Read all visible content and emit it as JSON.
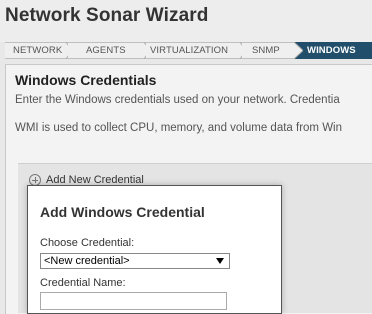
{
  "window": {
    "title": "Network Sonar Wizard"
  },
  "wizard": {
    "steps": [
      {
        "label": "NETWORK",
        "active": false
      },
      {
        "label": "AGENTS",
        "active": false
      },
      {
        "label": "VIRTUALIZATION",
        "active": false
      },
      {
        "label": "SNMP",
        "active": false
      },
      {
        "label": "WINDOWS",
        "active": true
      }
    ]
  },
  "main": {
    "heading": "Windows Credentials",
    "description": "Enter the Windows credentials used on your network. Credentia",
    "wmi_note": "WMI is used to collect CPU, memory, and volume data from Win",
    "add_credential_label": "Add New Credential"
  },
  "dialog": {
    "title": "Add Windows Credential",
    "choose_label": "Choose Credential:",
    "choose_value": "<New credential>",
    "name_label": "Credential Name:",
    "name_value": "",
    "name_placeholder": ""
  },
  "colors": {
    "active_step": "#214f6b",
    "background": "#e8e8e8"
  }
}
